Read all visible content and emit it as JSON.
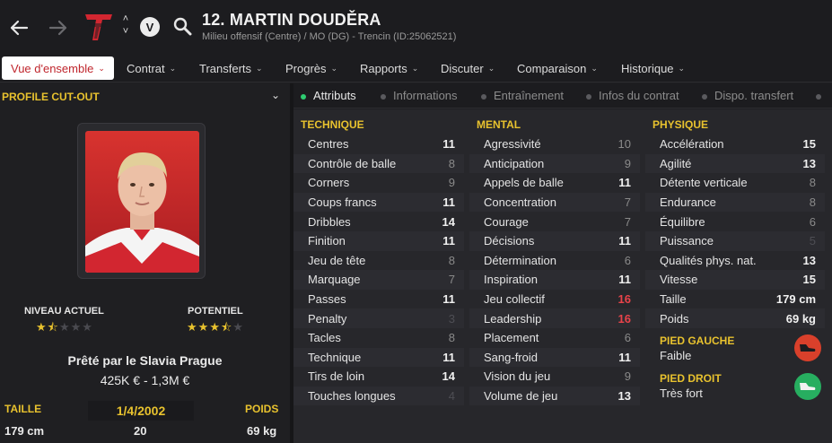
{
  "header": {
    "title": "12. MARTIN DOUDĚRA",
    "subtitle": "Milieu offensif (Centre) / MO (DG) - Trencin (ID:25062521)",
    "badge": "V"
  },
  "menu": [
    {
      "label": "Vue d'ensemble",
      "active": true
    },
    {
      "label": "Contrat"
    },
    {
      "label": "Transferts"
    },
    {
      "label": "Progrès"
    },
    {
      "label": "Rapports"
    },
    {
      "label": "Discuter"
    },
    {
      "label": "Comparaison"
    },
    {
      "label": "Historique"
    }
  ],
  "left": {
    "profile_header": "PROFILE CUT-OUT",
    "current_ability_label": "NIVEAU ACTUEL",
    "current_ability_stars": 1.5,
    "potential_label": "POTENTIEL",
    "potential_stars": 3.5,
    "loan_text": "Prêté par le Slavia Prague",
    "value_text": "425K € - 1,3M €",
    "height_label": "TAILLE",
    "height_value": "179 cm",
    "dob": "1/4/2002",
    "age": "20",
    "weight_label": "POIDS",
    "weight_value": "69 kg"
  },
  "tabs": [
    {
      "label": "Attributs",
      "active": true
    },
    {
      "label": "Informations"
    },
    {
      "label": "Entraînement"
    },
    {
      "label": "Infos du contrat"
    },
    {
      "label": "Dispo. transfert"
    }
  ],
  "attributes": {
    "technique": {
      "title": "TECHNIQUE",
      "items": [
        {
          "name": "Centres",
          "value": "11",
          "tone": "hi"
        },
        {
          "name": "Contrôle de balle",
          "value": "8",
          "tone": "mid"
        },
        {
          "name": "Corners",
          "value": "9",
          "tone": "mid"
        },
        {
          "name": "Coups francs",
          "value": "11",
          "tone": "hi"
        },
        {
          "name": "Dribbles",
          "value": "14",
          "tone": "hi"
        },
        {
          "name": "Finition",
          "value": "11",
          "tone": "hi"
        },
        {
          "name": "Jeu de tête",
          "value": "8",
          "tone": "mid"
        },
        {
          "name": "Marquage",
          "value": "7",
          "tone": "mid"
        },
        {
          "name": "Passes",
          "value": "11",
          "tone": "hi"
        },
        {
          "name": "Penalty",
          "value": "3",
          "tone": "low"
        },
        {
          "name": "Tacles",
          "value": "8",
          "tone": "mid"
        },
        {
          "name": "Technique",
          "value": "11",
          "tone": "hi"
        },
        {
          "name": "Tirs de loin",
          "value": "14",
          "tone": "hi"
        },
        {
          "name": "Touches longues",
          "value": "4",
          "tone": "low"
        }
      ]
    },
    "mental": {
      "title": "MENTAL",
      "items": [
        {
          "name": "Agressivité",
          "value": "10",
          "tone": "mid"
        },
        {
          "name": "Anticipation",
          "value": "9",
          "tone": "mid"
        },
        {
          "name": "Appels de balle",
          "value": "11",
          "tone": "hi"
        },
        {
          "name": "Concentration",
          "value": "7",
          "tone": "mid"
        },
        {
          "name": "Courage",
          "value": "7",
          "tone": "mid"
        },
        {
          "name": "Décisions",
          "value": "11",
          "tone": "hi"
        },
        {
          "name": "Détermination",
          "value": "6",
          "tone": "mid"
        },
        {
          "name": "Inspiration",
          "value": "11",
          "tone": "hi"
        },
        {
          "name": "Jeu collectif",
          "value": "16",
          "tone": "red"
        },
        {
          "name": "Leadership",
          "value": "16",
          "tone": "red"
        },
        {
          "name": "Placement",
          "value": "6",
          "tone": "mid"
        },
        {
          "name": "Sang-froid",
          "value": "11",
          "tone": "hi"
        },
        {
          "name": "Vision du jeu",
          "value": "9",
          "tone": "mid"
        },
        {
          "name": "Volume de jeu",
          "value": "13",
          "tone": "hi"
        }
      ]
    },
    "physique": {
      "title": "PHYSIQUE",
      "items": [
        {
          "name": "Accélération",
          "value": "15",
          "tone": "hi"
        },
        {
          "name": "Agilité",
          "value": "13",
          "tone": "hi"
        },
        {
          "name": "Détente verticale",
          "value": "8",
          "tone": "mid"
        },
        {
          "name": "Endurance",
          "value": "8",
          "tone": "mid"
        },
        {
          "name": "Équilibre",
          "value": "6",
          "tone": "mid"
        },
        {
          "name": "Puissance",
          "value": "5",
          "tone": "low"
        },
        {
          "name": "Qualités phys. nat.",
          "value": "13",
          "tone": "hi"
        },
        {
          "name": "Vitesse",
          "value": "15",
          "tone": "hi"
        },
        {
          "name": "Taille",
          "value": "179 cm",
          "tone": "hi"
        },
        {
          "name": "Poids",
          "value": "69 kg",
          "tone": "hi"
        }
      ]
    },
    "feet": {
      "left_label": "PIED GAUCHE",
      "left_value": "Faible",
      "left_color": "#d9402b",
      "right_label": "PIED DROIT",
      "right_value": "Très fort",
      "right_color": "#27ae60"
    }
  },
  "colors": {
    "accent_yellow": "#e8c22e",
    "brand_red": "#c0262d",
    "highlight_red": "#e8434a"
  }
}
